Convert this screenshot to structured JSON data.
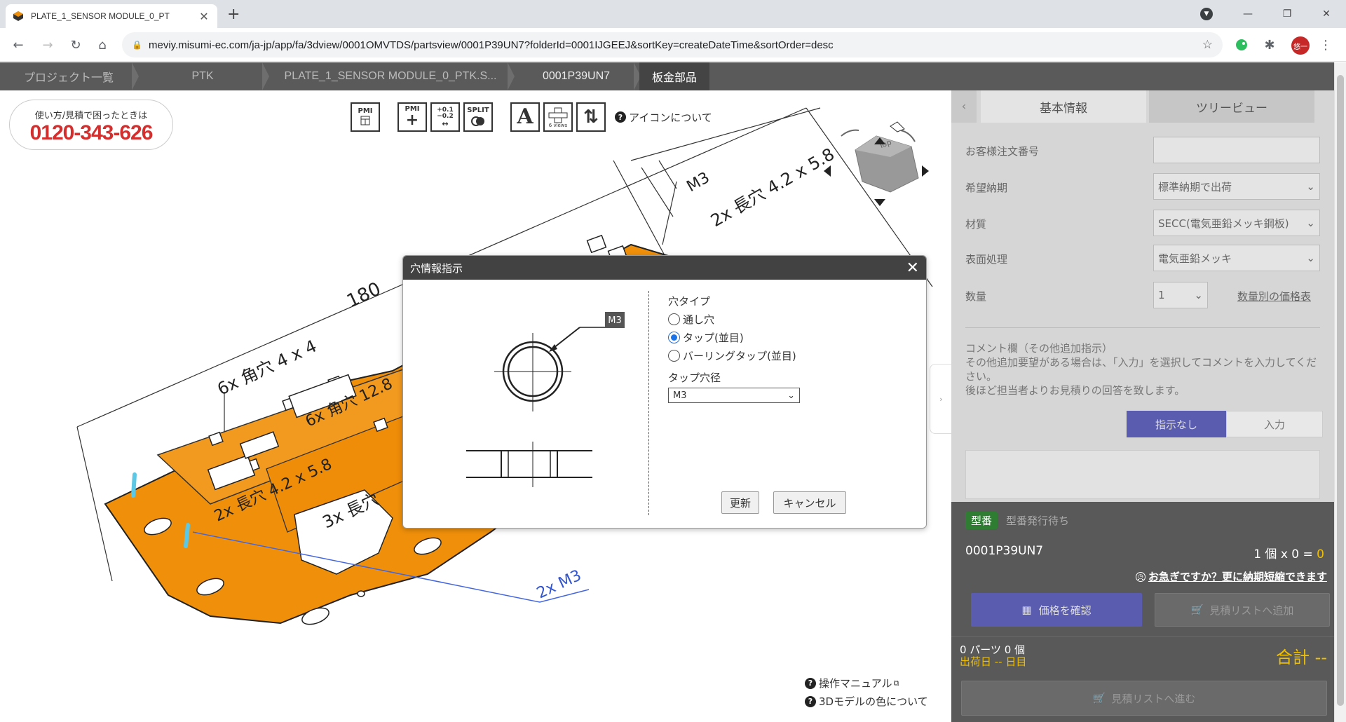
{
  "browser": {
    "tab_title": "PLATE_1_SENSOR MODULE_0_PT",
    "url": "meviy.misumi-ec.com/ja-jp/app/fa/3dview/0001OMVTDS/partsview/0001P39UN7?folderId=0001IJGEEJ&sortKey=createDateTime&sortOrder=desc",
    "profile_initial": "悠一"
  },
  "breadcrumb": [
    "プロジェクト一覧",
    "PTK",
    "PLATE_1_SENSOR MODULE_0_PTK.S...",
    "0001P39UN7",
    "板金部品"
  ],
  "support": {
    "caption": "使い方/見積で困ったときは",
    "phone": "0120-343-626"
  },
  "pmi_toolbar": {
    "about_icons": "アイコンについて",
    "split_label": "SPLIT",
    "views_label": "6 views"
  },
  "model_labels": {
    "dim_180": "180",
    "square_holes": "6x 角穴 4 x 4",
    "long_holes_top": "2x 長穴 4.2 x 5.8",
    "m3_top": "M3",
    "mid_label": "6x 角穴 12.8",
    "long_holes_mid": "2x 長穴 4.2 x 5.8",
    "long_holes_3x": "3x 長穴",
    "m3_count": "2x M3",
    "cube_top": "Top"
  },
  "links": {
    "manual": "操作マニュアル",
    "color_info": "3Dモデルの色について"
  },
  "dialog": {
    "title": "穴情報指示",
    "tag": "M3",
    "hole_type_label": "穴タイプ",
    "options": [
      "通し穴",
      "タップ(並目)",
      "バーリングタップ(並目)"
    ],
    "selected_option": 1,
    "tap_size_label": "タップ穴径",
    "tap_size_value": "M3",
    "update_button": "更新",
    "cancel_button": "キャンセル"
  },
  "panel": {
    "tabs": [
      "基本情報",
      "ツリービュー"
    ],
    "fields": {
      "order_no_label": "お客様注文番号",
      "order_no_value": "",
      "delivery_label": "希望納期",
      "delivery_value": "標準納期で出荷",
      "material_label": "材質",
      "material_value": "SECC(電気亜鉛メッキ鋼板)",
      "surface_label": "表面処理",
      "surface_value": "電気亜鉛メッキ",
      "qty_label": "数量",
      "qty_value": "1",
      "price_table_link": "数量別の価格表"
    },
    "comment": {
      "title": "コメント欄（その他追加指示）",
      "line1": "その他追加要望がある場合は、「入力」を選択してコメントを入力してください。",
      "line2": "後ほど担当者よりお見積りの回答を致します。",
      "seg_none": "指示なし",
      "seg_input": "入力"
    },
    "bottom": {
      "badge": "型番",
      "status": "型番発行待ち",
      "part_no": "0001P39UN7",
      "qty_calc": "1 個  x 0 =",
      "rush_link": "お急ぎですか？更に納期短縮できます",
      "check_price": "価格を確認",
      "add_to_list": "見積リストへ追加",
      "parts_count": "0 パーツ 0 個",
      "ship_date": "出荷日 -- 日目",
      "total": "合計 --",
      "proceed": "見積リストへ進む"
    }
  },
  "colors": {
    "part_orange": "#f0900a",
    "dialog_header": "#424242",
    "accent_blue": "#5a5cb0",
    "phone_red": "#d32f2f"
  }
}
